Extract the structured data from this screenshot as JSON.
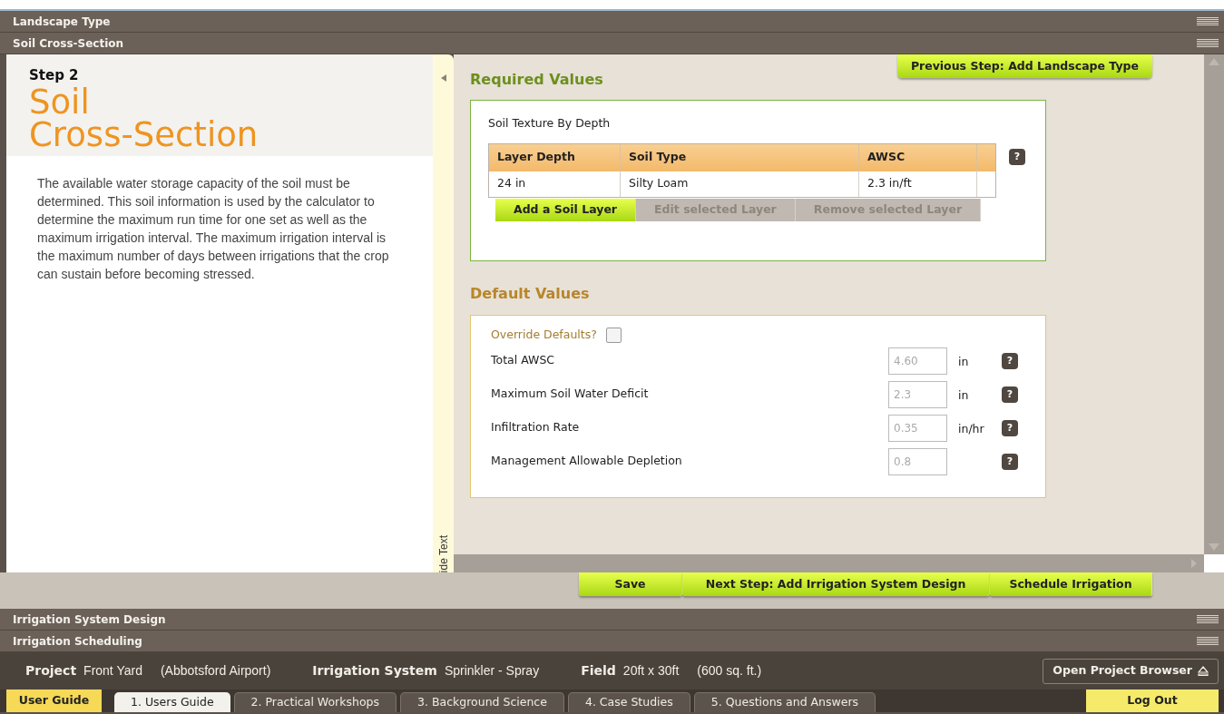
{
  "sections_top": [
    {
      "title": "Landscape Type"
    },
    {
      "title": "Soil Cross-Section"
    }
  ],
  "step": {
    "label": "Step 2",
    "title_lines": [
      "Soil",
      "Cross-Section"
    ],
    "description": "The available water storage capacity of the soil must be determined. This soil information is used by the calculator to determine the maximum run time for one set as well as the maximum irrigation interval. The maximum irrigation interval is the maximum number of days between irrigations that the crop can sustain before becoming stressed."
  },
  "side_toggle": {
    "label": "ide Text"
  },
  "previous_button": "Previous Step: Add Landscape Type",
  "required": {
    "heading": "Required Values",
    "table_title": "Soil Texture By Depth",
    "columns": [
      "Layer Depth",
      "Soil Type",
      "AWSC"
    ],
    "rows": [
      [
        "24 in",
        "Silty Loam",
        "2.3 in/ft"
      ]
    ],
    "help": "?",
    "buttons": [
      {
        "label": "Add a Soil Layer",
        "disabled": false
      },
      {
        "label": "Edit selected Layer",
        "disabled": true
      },
      {
        "label": "Remove selected Layer",
        "disabled": true
      }
    ]
  },
  "defaults": {
    "heading": "Default Values",
    "override": {
      "label": "Override Defaults?",
      "checked": false
    },
    "fields": [
      {
        "label": "Total AWSC",
        "value": "4.60",
        "unit": "in",
        "disabled": true,
        "help": "?"
      },
      {
        "label": "Maximum Soil Water Deficit",
        "value": "2.3",
        "unit": "in",
        "disabled": true,
        "help": "?"
      },
      {
        "label": "Infiltration Rate",
        "value": "0.35",
        "unit": "in/hr",
        "disabled": true,
        "help": "?"
      },
      {
        "label": "Management Allowable Depletion",
        "value": "0.8",
        "disabled": true,
        "help": "?"
      }
    ]
  },
  "actions": [
    "Save",
    "Next Step: Add Irrigation System Design",
    "Schedule Irrigation"
  ],
  "sections_bottom": [
    {
      "title": "Irrigation System Design"
    },
    {
      "title": "Irrigation Scheduling"
    }
  ],
  "project_bar": {
    "items": [
      {
        "label": "Project",
        "values": [
          "Front Yard",
          "(Abbotsford Airport)"
        ]
      },
      {
        "label": "Irrigation System",
        "values": [
          "Sprinkler - Spray"
        ]
      },
      {
        "label": "Field",
        "values": [
          "20ft x 30ft",
          "(600 sq. ft.)"
        ]
      }
    ],
    "browser_button": "Open Project Browser"
  },
  "guide": {
    "label": "User Guide",
    "tabs": [
      {
        "label": "1. Users Guide",
        "selected": true
      },
      {
        "label": "2. Practical Workshops",
        "selected": false
      },
      {
        "label": "3. Background Science",
        "selected": false
      },
      {
        "label": "4. Case Studies",
        "selected": false
      },
      {
        "label": "5. Questions and Answers",
        "selected": false
      }
    ],
    "logout": "Log Out"
  }
}
